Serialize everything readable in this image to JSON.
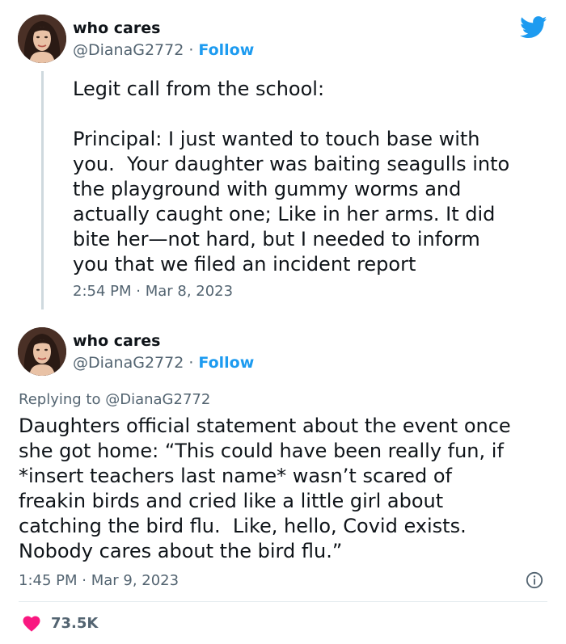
{
  "tweet1": {
    "name": "who cares",
    "handle": "@DianaG2772",
    "separator": "·",
    "follow_label": "Follow",
    "text": "Legit call from the school:\n\nPrincipal: I just wanted to touch base with\nyou.  Your daughter was baiting seagulls into\nthe playground with gummy worms and\nactually caught one; Like in her arms. It did\nbite her—not hard, but I needed to inform\nyou that we filed an incident report",
    "time": "2:54 PM",
    "date": "Mar 8, 2023"
  },
  "tweet2": {
    "name": "who cares",
    "handle": "@DianaG2772",
    "separator": "·",
    "follow_label": "Follow",
    "replying_prefix": "Replying to",
    "replying_handle": "@DianaG2772",
    "text": "Daughters official statement about the event once\nshe got home: “This could have been really fun, if\n*insert teachers last name* wasn’t scared of\nfreakin birds and cried like a little girl about\ncatching the bird flu.  Like, hello, Covid exists.\nNobody cares about the bird flu.”",
    "time": "1:45 PM",
    "date": "Mar 9, 2023",
    "like_count": "73.5K"
  },
  "icons": {
    "brand": "twitter-bird-icon",
    "info": "info-icon",
    "like": "heart-icon"
  },
  "colors": {
    "brand_blue": "#1d9bf0",
    "text": "#0f1419",
    "muted": "#536471",
    "heart": "#f91880",
    "thread_line": "#cfd9de"
  }
}
